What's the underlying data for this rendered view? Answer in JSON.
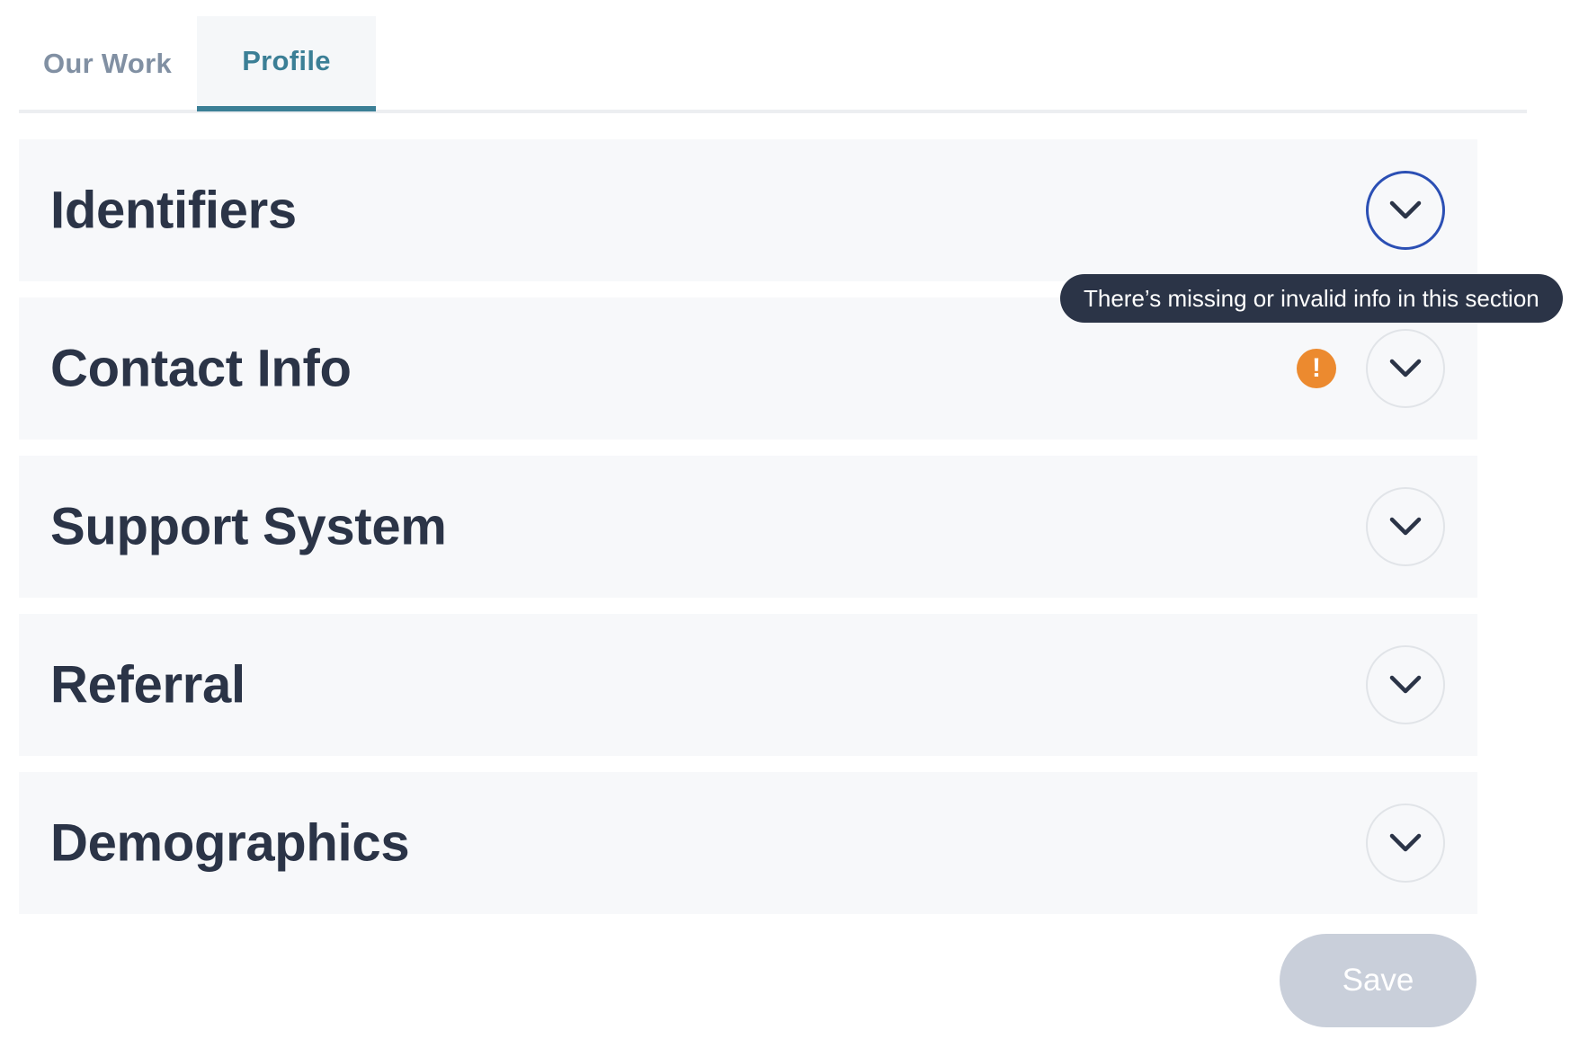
{
  "tabs": [
    {
      "label": "Our Work",
      "active": false
    },
    {
      "label": "Profile",
      "active": true
    }
  ],
  "sections": [
    {
      "title": "Identifiers",
      "warning": false
    },
    {
      "title": "Contact Info",
      "warning": true,
      "warning_glyph": "!"
    },
    {
      "title": "Support System",
      "warning": false
    },
    {
      "title": "Referral",
      "warning": false
    },
    {
      "title": "Demographics",
      "warning": false
    }
  ],
  "tooltip": {
    "text": "There’s missing or invalid info in this section"
  },
  "save_label": "Save",
  "icons": {
    "expand": "chevron-down-icon",
    "warning": "exclamation-circle-icon"
  },
  "colors": {
    "accent": "#3b7f96",
    "text": "#2b3447",
    "warning": "#ec8a2f",
    "focus_ring": "#2b4fb4",
    "disabled_button": "#c9cfda"
  }
}
